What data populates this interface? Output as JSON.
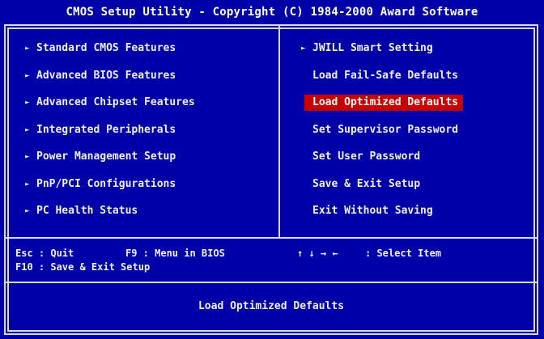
{
  "title": "CMOS Setup Utility - Copyright (C) 1984-2000 Award Software",
  "left_menu": [
    {
      "label": "Standard CMOS Features",
      "arrow": "►"
    },
    {
      "label": "Advanced BIOS Features",
      "arrow": "►"
    },
    {
      "label": "Advanced Chipset Features",
      "arrow": "►"
    },
    {
      "label": "Integrated Peripherals",
      "arrow": "►"
    },
    {
      "label": "Power Management Setup",
      "arrow": "►"
    },
    {
      "label": "PnP/PCI Configurations",
      "arrow": "►"
    },
    {
      "label": "PC Health Status",
      "arrow": "►"
    }
  ],
  "right_menu": [
    {
      "label": "JWILL Smart Setting",
      "arrow": "►"
    },
    {
      "label": "Load Fail-Safe Defaults"
    },
    {
      "label": "Load Optimized Defaults",
      "selected": true
    },
    {
      "label": "Set Supervisor Password"
    },
    {
      "label": "Set User Password"
    },
    {
      "label": "Save & Exit Setup"
    },
    {
      "label": "Exit Without Saving"
    }
  ],
  "help": {
    "esc": "Esc : Quit",
    "f9": "F9 : Menu in BIOS",
    "f10": "F10 : Save & Exit Setup",
    "arrows": "↑ ↓ → ←",
    "select": ": Select Item"
  },
  "status": "Load Optimized Defaults",
  "colors": {
    "background": "#0000a8",
    "highlight": "#c80000",
    "text": "#f0f0f0",
    "border": "#d8d8e8"
  }
}
